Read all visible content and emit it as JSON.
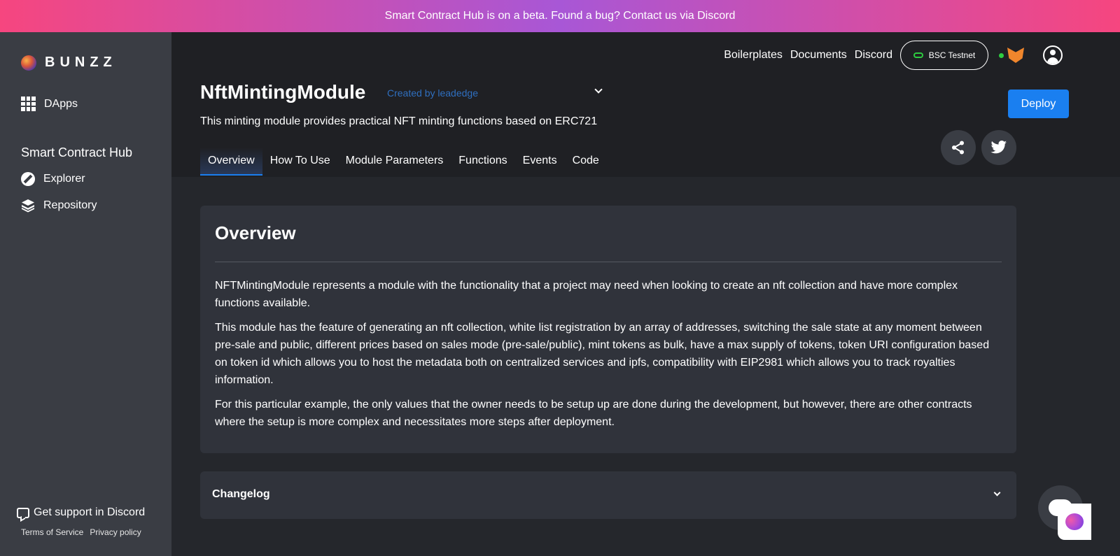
{
  "banner": {
    "text": "Smart Contract Hub is on a beta. Found a bug? Contact us via Discord"
  },
  "sidebar": {
    "logo_text": "BUNZZ",
    "dapps_label": "DApps",
    "section_heading": "Smart Contract Hub",
    "items": [
      {
        "label": "Explorer",
        "icon": "compass-icon"
      },
      {
        "label": "Repository",
        "icon": "layers-icon"
      }
    ],
    "support_label": "Get support in Discord",
    "terms_label": "Terms of Service",
    "privacy_label": "Privacy policy"
  },
  "topnav": {
    "links": [
      "Boilerplates",
      "Documents",
      "Discord"
    ],
    "network_label": "BSC Testnet"
  },
  "module": {
    "title": "NftMintingModule",
    "created_by": "Created by leadedge",
    "description": "This minting module provides practical NFT minting functions based on ERC721",
    "deploy_label": "Deploy"
  },
  "tabs": [
    "Overview",
    "How To Use",
    "Module Parameters",
    "Functions",
    "Events",
    "Code"
  ],
  "active_tab": "Overview",
  "overview": {
    "title": "Overview",
    "paragraphs": [
      "NFTMintingModule represents a module with the functionality that a project may need when looking to create an nft collection and have more complex functions available.",
      "This module has the feature of generating an nft collection, white list registration by an array of addresses, switching the sale state at any moment between pre-sale and public, different prices based on sales mode (pre-sale/public), mint tokens as bulk, have a max supply of tokens, token URI configuration based on token id which allows you to host the metadata both on centralized services and ipfs, compatibility with EIP2981 which allows you to track royalties information.",
      "For this particular example, the only values that the owner needs to be setup up are done during the development, but however, there are other contracts where the setup is more complex and necessitates more steps after deployment."
    ]
  },
  "changelog": {
    "label": "Changelog"
  },
  "colors": {
    "accent": "#1a7ff0",
    "sidebar": "#3a3d44",
    "background": "#25272c",
    "card": "#30333b",
    "link": "#2f6fbf",
    "online": "#2ecc40"
  }
}
